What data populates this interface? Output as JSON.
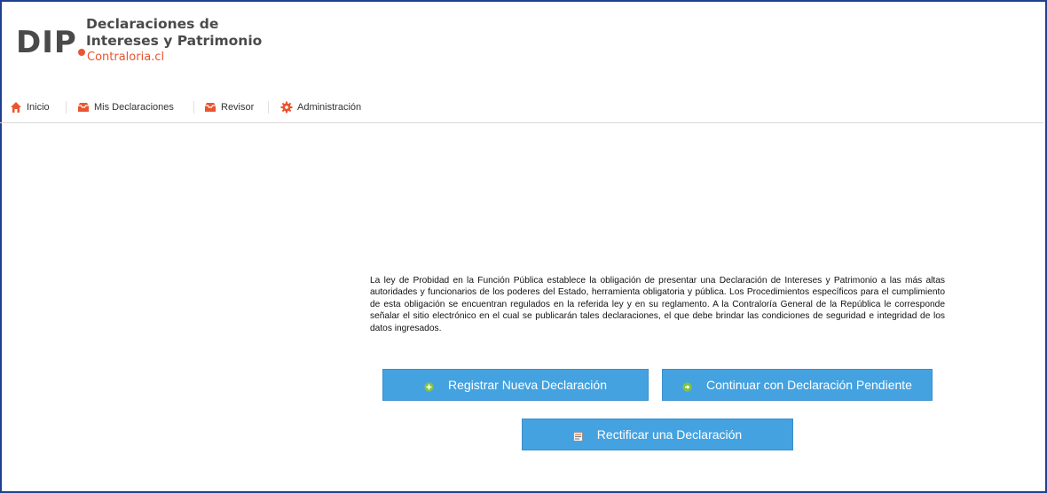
{
  "logo": {
    "mark": "DIP",
    "title_line1": "Declaraciones de",
    "title_line2": "Intereses y Patrimonio",
    "subtitle": "Contraloria.cl"
  },
  "nav": {
    "items": [
      {
        "label": "Inicio",
        "icon": "home-icon"
      },
      {
        "label": "Mis Declaraciones",
        "icon": "inbox-icon"
      },
      {
        "label": "Revisor",
        "icon": "inbox-icon"
      },
      {
        "label": "Administración",
        "icon": "gear-icon"
      }
    ]
  },
  "main": {
    "intro": "La ley de Probidad en la Función Pública establece la obligación de presentar una Declaración de Intereses y Patrimonio a las más altas autoridades y funcionarios de los poderes del Estado, herramienta obligatoria y pública. Los Procedimientos específicos para el cumplimiento de esta obligación se encuentran regulados en la referida ley y en su reglamento. A la Contraloría General de la República le corresponde señalar el sitio electrónico en el cual se publicarán tales declaraciones, el que debe brindar las condiciones de seguridad e integridad de los datos ingresados.",
    "btn_new": "Registrar Nueva Declaración",
    "btn_continue": "Continuar con Declaración Pendiente",
    "btn_rectify": "Rectificar una Declaración"
  },
  "colors": {
    "accent": "#e9552f",
    "button": "#44a2e0",
    "frame": "#1f3f8f"
  }
}
